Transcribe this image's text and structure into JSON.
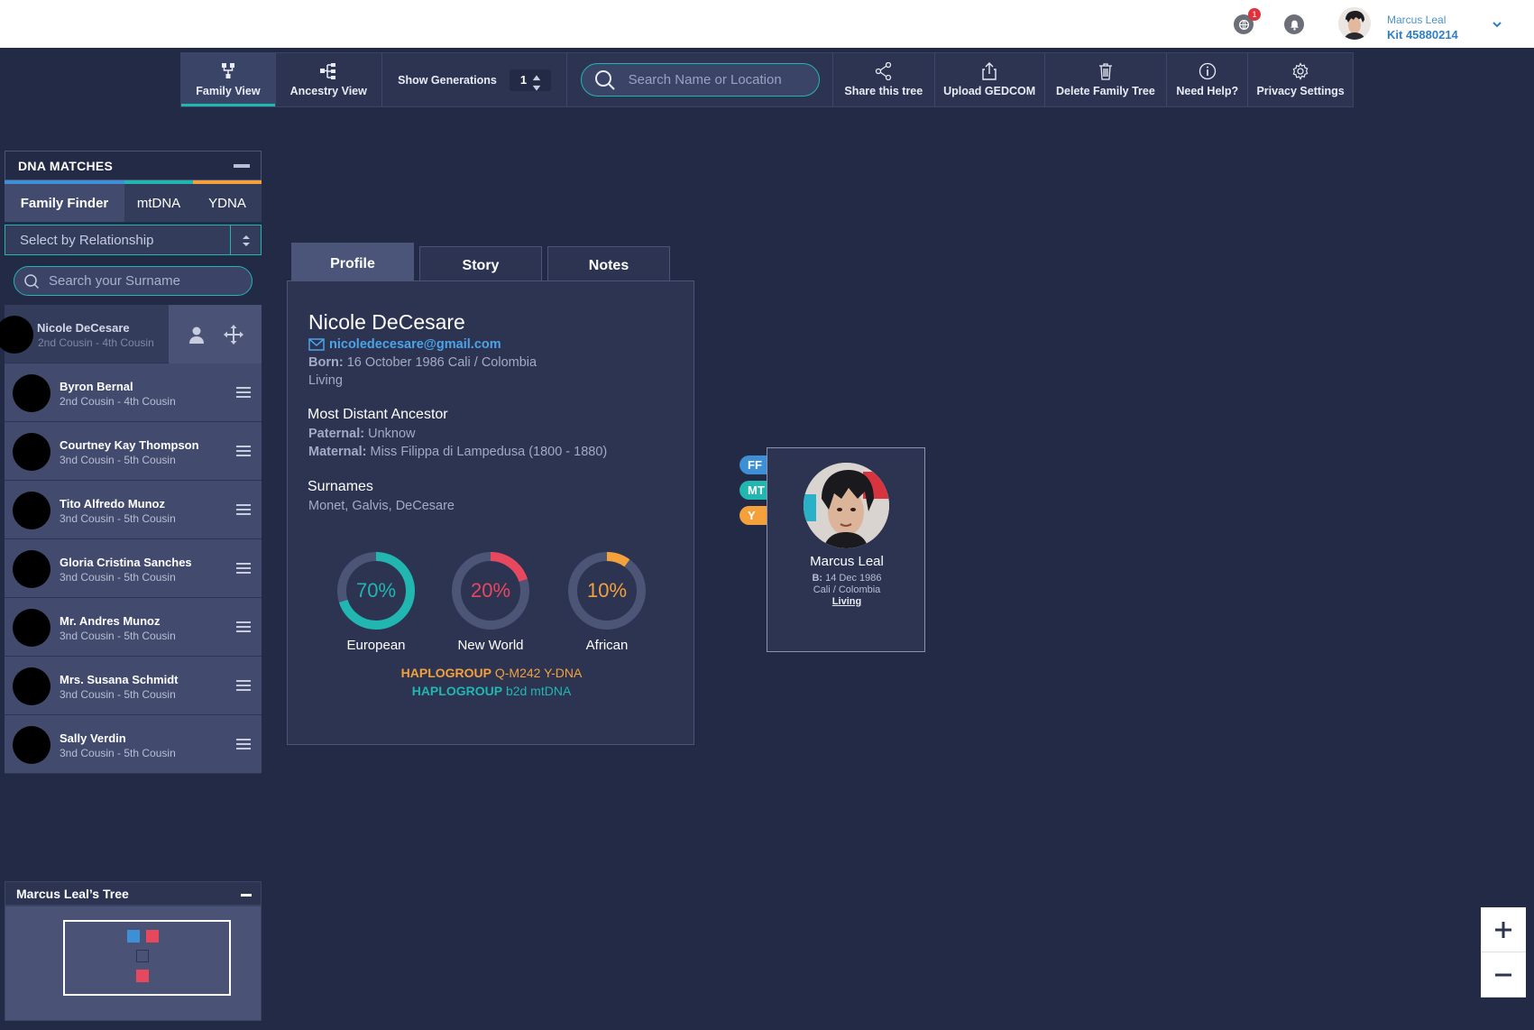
{
  "topbar": {
    "notification_count": "1",
    "user_name": "Marcus Leal",
    "user_kit": "Kit 45880214",
    "icons": [
      "globe-icon",
      "bell-icon",
      "chevron-down-icon"
    ]
  },
  "toolbar": {
    "family_view": "Family View",
    "ancestry_view": "Ancestry View",
    "show_generations_label": "Show Generations",
    "generations_value": "1",
    "search_placeholder": "Search Name or Location",
    "share": "Share this tree",
    "upload": "Upload GEDCOM",
    "delete": "Delete Family Tree",
    "help": "Need Help?",
    "privacy": "Privacy Settings"
  },
  "dna_panel": {
    "title": "DNA MATCHES",
    "tabs": [
      "Family Finder",
      "mtDNA",
      "YDNA"
    ],
    "relationship_select": "Select by Relationship",
    "surname_placeholder": "Search your Surname",
    "matches": [
      {
        "name": "Nicole DeCesare",
        "relation": "2nd Cousin - 4th Cousin"
      },
      {
        "name": "Byron Bernal",
        "relation": "2nd Cousin - 4th Cousin"
      },
      {
        "name": "Courtney Kay Thompson",
        "relation": "3nd Cousin - 5th Cousin"
      },
      {
        "name": "Tito Alfredo Munoz",
        "relation": "3nd Cousin - 5th Cousin"
      },
      {
        "name": "Gloria Cristina Sanches",
        "relation": "3nd Cousin - 5th Cousin"
      },
      {
        "name": "Mr. Andres Munoz",
        "relation": "3nd Cousin - 5th Cousin"
      },
      {
        "name": "Mrs. Susana Schmidt",
        "relation": "3nd Cousin - 5th Cousin"
      },
      {
        "name": "Sally Verdin",
        "relation": "3nd Cousin - 5th Cousin"
      }
    ]
  },
  "profile": {
    "tabs": [
      "Profile",
      "Story",
      "Notes"
    ],
    "name": "Nicole DeCesare",
    "email": "nicoledecesare@gmail.com",
    "born_label": "Born:",
    "born_value": "16 October 1986 Cali / Colombia",
    "status": "Living",
    "ancestor_title": "Most Distant Ancestor",
    "paternal_label": "Paternal:",
    "paternal_value": "Unknow",
    "maternal_label": "Maternal:",
    "maternal_value": "Miss Filippa di Lampedusa (1800 - 1880)",
    "surnames_title": "Surnames",
    "surnames_value": "Monet, Galvis, DeCesare",
    "ethnicity": [
      {
        "label": "European",
        "percent": "70%",
        "value": 70,
        "color": "#21b6b0"
      },
      {
        "label": "New World",
        "percent": "20%",
        "value": 20,
        "color": "#e8485e"
      },
      {
        "label": "African",
        "percent": "10%",
        "value": 10,
        "color": "#f4a13c"
      }
    ],
    "haplogroup_label": "HAPLOGROUP",
    "ydna_value": "Q-M242 Y-DNA",
    "mtdna_value": "b2d mtDNA"
  },
  "tree_node": {
    "badges": [
      "FF",
      "MT",
      "Y"
    ],
    "name": "Marcus Leal",
    "born_label": "B:",
    "born_value": "14 Dec 1986",
    "place": "Cali / Colombia",
    "status": "Living"
  },
  "mini_tree": {
    "title": "Marcus Leal’s Tree"
  },
  "colors": {
    "teal": "#21b6b0",
    "blue": "#3d8fd6",
    "orange": "#f4a13c",
    "red": "#e8485e",
    "background": "#232a45"
  }
}
